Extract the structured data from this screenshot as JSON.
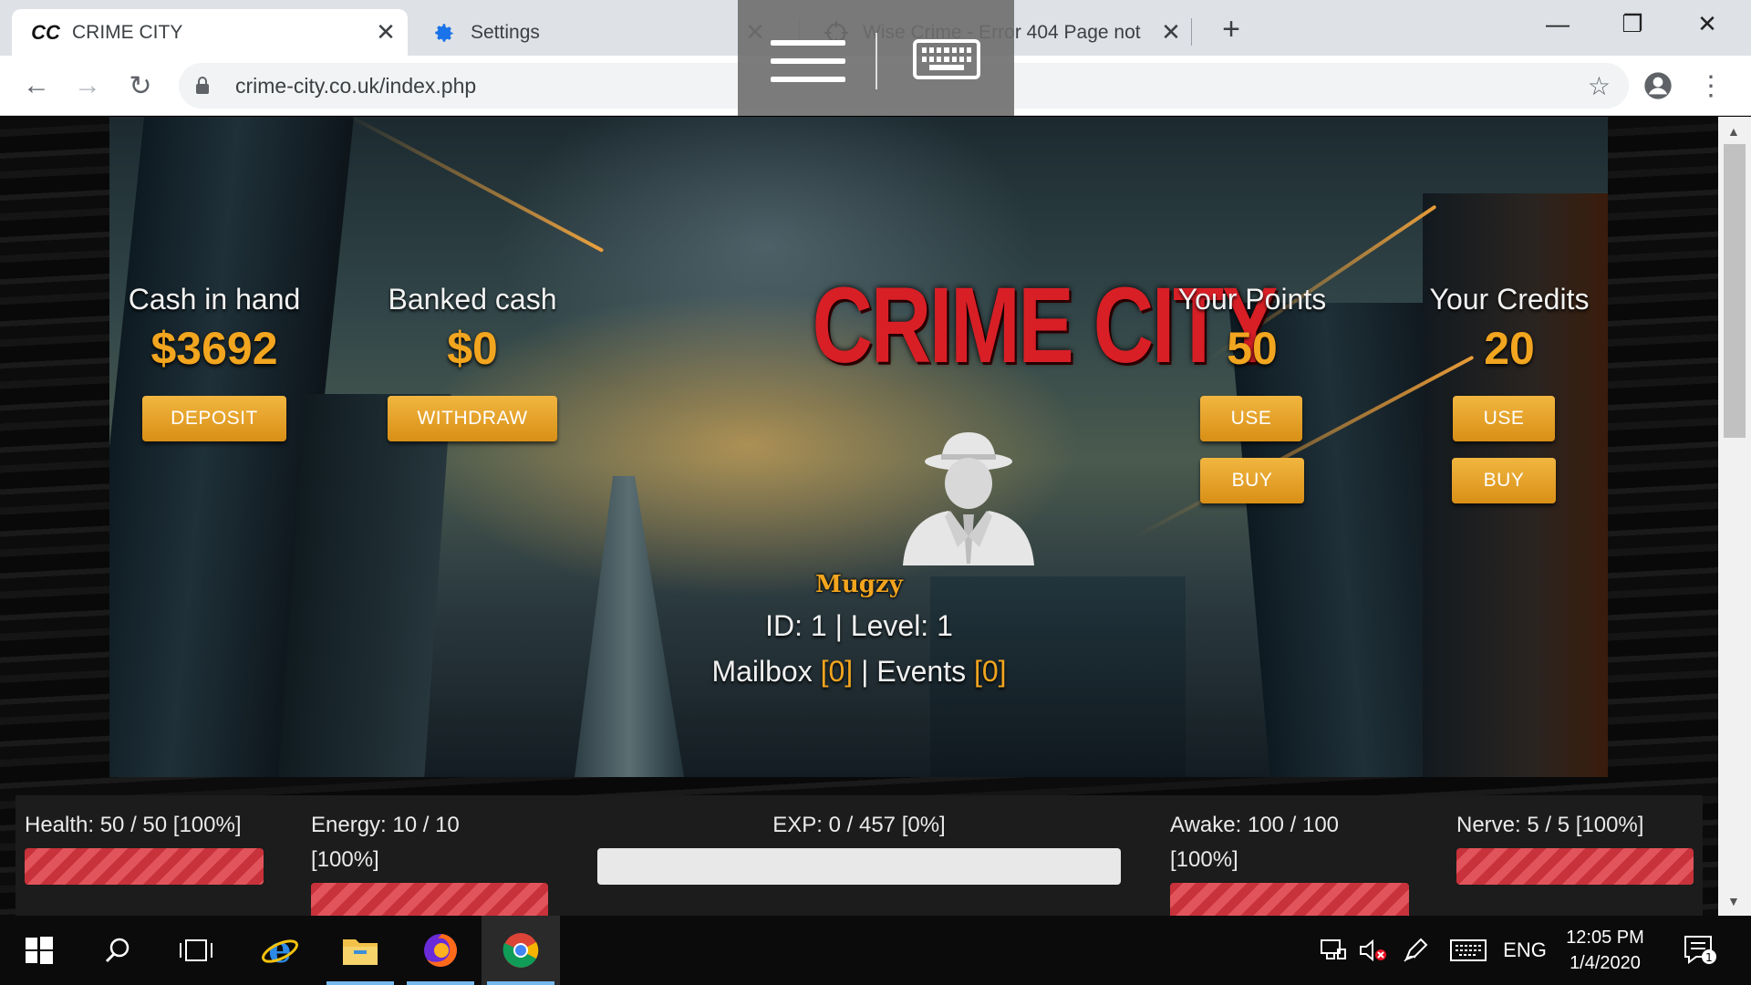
{
  "browser": {
    "tabs": [
      {
        "title": "CRIME CITY",
        "favicon": "CC"
      },
      {
        "title": "Settings"
      },
      {
        "title": "Wise Crime - Error 404 Page not"
      }
    ],
    "url": "crime-city.co.uk/index.php"
  },
  "game": {
    "logo": "CRIME CITY",
    "cash": {
      "label": "Cash in hand",
      "value": "$3692",
      "button": "DEPOSIT"
    },
    "bank": {
      "label": "Banked cash",
      "value": "$0",
      "button": "WITHDRAW"
    },
    "points": {
      "label": "Your Points",
      "value": "50",
      "use": "USE",
      "buy": "BUY"
    },
    "credits": {
      "label": "Your Credits",
      "value": "20",
      "use": "USE",
      "buy": "BUY"
    },
    "user": {
      "name": "Mugzy",
      "id_text": "ID: 1",
      "sep": "|",
      "level_text": "Level: 1",
      "mailbox_label": "Mailbox",
      "mailbox_count": "[0]",
      "events_label": "Events",
      "events_count": "[0]"
    },
    "stats": {
      "health": {
        "text": "Health: 50 / 50 [100%]",
        "percent": 100
      },
      "energy": {
        "line1": "Energy: 10 / 10",
        "line2": "[100%]",
        "percent": 100
      },
      "exp": {
        "text": "EXP: 0 / 457 [0%]",
        "percent": 0
      },
      "awake": {
        "line1": "Awake: 100 / 100",
        "line2": "[100%]",
        "percent": 100
      },
      "nerve": {
        "text": "Nerve: 5 / 5 [100%]",
        "percent": 100
      }
    }
  },
  "taskbar": {
    "lang": "ENG",
    "time": "12:05 PM",
    "date": "1/4/2020",
    "notification_count": "1"
  }
}
